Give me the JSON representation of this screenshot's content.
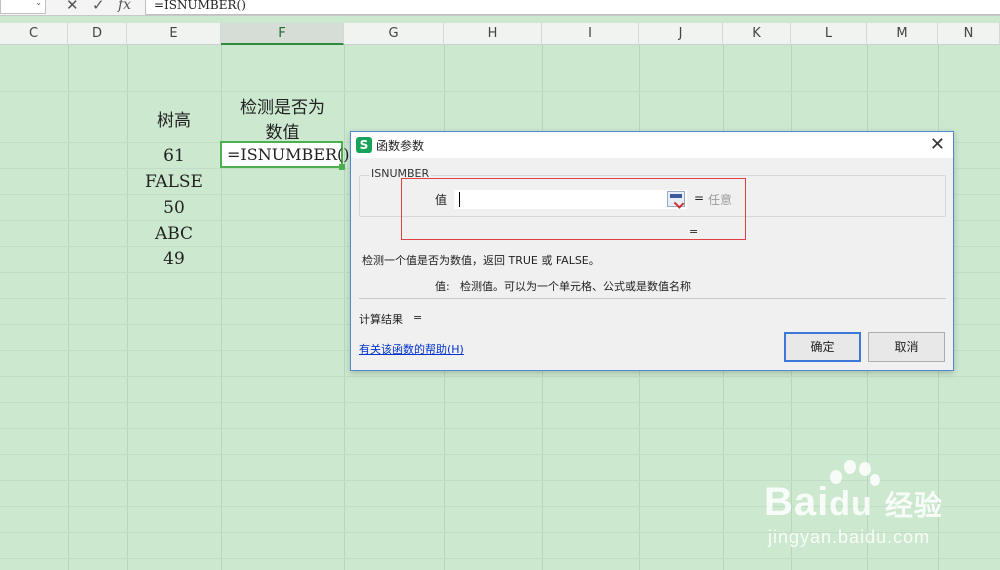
{
  "formula_bar": {
    "name_box_value": "",
    "cancel_icon": "x-icon",
    "confirm_icon": "check-icon",
    "fx_label": "fx",
    "formula": "=ISNUMBER()"
  },
  "columns": [
    "C",
    "D",
    "E",
    "F",
    "G",
    "H",
    "I",
    "J",
    "K",
    "L",
    "M",
    "N"
  ],
  "selected_column": "F",
  "sheet": {
    "header_e": "树高",
    "header_f_line1": "检测是否为",
    "header_f_line2": "数值",
    "values_e": [
      "61",
      "FALSE",
      "50",
      "ABC",
      "49"
    ],
    "active_cell_text": "=ISNUMBER()"
  },
  "dialog": {
    "title": "函数参数",
    "logo_letter": "S",
    "function_name": "ISNUMBER",
    "arg_label": "值",
    "arg_value": "",
    "arg_equals": "=",
    "arg_hint": "任意",
    "result_equals": "=",
    "description": "检测一个值是否为数值，返回 TRUE 或 FALSE。",
    "arg_desc_name": "值:",
    "arg_desc": "检测值。可以为一个单元格、公式或是数值名称",
    "calc_label": "计算结果",
    "calc_equals": "=",
    "help_link": "有关该函数的帮助(H)",
    "ok_label": "确定",
    "cancel_label": "取消"
  },
  "watermark": {
    "brand": "Bai",
    "brand_tail": "经验",
    "url": "jingyan.baidu.com"
  },
  "colors": {
    "sheet_background": "#cce8cf",
    "active_cell_border": "#4caf50",
    "highlight_frame": "#e04040",
    "link": "#0033cc"
  }
}
